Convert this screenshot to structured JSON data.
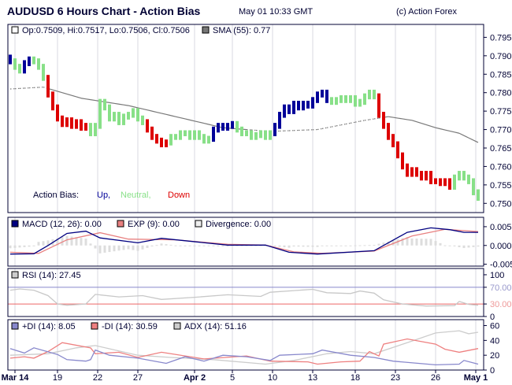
{
  "header": {
    "title": "AUDUSD 6 Hours Chart - Action Bias",
    "timestamp": "May 01 10:33 GMT",
    "credit": "(c) Action Forex"
  },
  "colors": {
    "up": "#000099",
    "neutral": "#88e088",
    "down": "#dd0000",
    "sma": "#777777",
    "macd": "#000080",
    "exp": "#e88080",
    "div": "#dddddd",
    "rsi": "#c8c8c8",
    "plusdi": "#8888cc",
    "minusdi": "#ee8080",
    "adx": "#cccccc",
    "grid": "#d8d8e0",
    "frame": "#000033"
  },
  "chart_data": [
    {
      "type": "bar",
      "title": "Price",
      "legend": {
        "ohlc": "Op:0.7509, Hi:0.7517, Lo:0.7506, Cl:0.7506",
        "sma": "SMA (55): 0.77"
      },
      "bias_legend": {
        "label": "Action Bias:",
        "up": "Up,",
        "neutral": "Neutral,",
        "down": "Down"
      },
      "ylim": [
        0.7475,
        0.7985
      ],
      "yticks": [
        "0.795",
        "0.790",
        "0.785",
        "0.780",
        "0.775",
        "0.770",
        "0.765",
        "0.760",
        "0.755",
        "0.750"
      ],
      "closes": [
        0.7885,
        0.787,
        0.786,
        0.788,
        0.789,
        0.7885,
        0.787,
        0.784,
        0.7795,
        0.776,
        0.773,
        0.7715,
        0.7725,
        0.771,
        0.772,
        0.7705,
        0.771,
        0.769,
        0.771,
        0.7775,
        0.776,
        0.773,
        0.774,
        0.772,
        0.7735,
        0.774,
        0.775,
        0.773,
        0.772,
        0.77,
        0.768,
        0.767,
        0.766,
        0.7665,
        0.768,
        0.768,
        0.769,
        0.769,
        0.768,
        0.769,
        0.768,
        0.767,
        0.7675,
        0.77,
        0.771,
        0.7705,
        0.771,
        0.7715,
        0.77,
        0.769,
        0.769,
        0.768,
        0.7685,
        0.769,
        0.768,
        0.769,
        0.771,
        0.774,
        0.776,
        0.775,
        0.777,
        0.776,
        0.777,
        0.7765,
        0.778,
        0.7795,
        0.78,
        0.778,
        0.7775,
        0.778,
        0.7785,
        0.778,
        0.7785,
        0.777,
        0.7775,
        0.779,
        0.78,
        0.779,
        0.774,
        0.771,
        0.768,
        0.766,
        0.763,
        0.76,
        0.758,
        0.759,
        0.758,
        0.757,
        0.758,
        0.756,
        0.756,
        0.7555,
        0.756,
        0.7545,
        0.757,
        0.758,
        0.757,
        0.756,
        0.753,
        0.7515
      ],
      "bias": "UNNUUNNNDDDDDDDDDNNNNNNNNNNNNDDDDDNNNNNNNNNUUUUUNNNNNNNNUUUUUUUUUUUUNNNNNNNNNNDDDDDDDDDDDDDDDDNNNNNN",
      "sma": [
        [
          0,
          0.781
        ],
        [
          7,
          0.7815
        ],
        [
          15,
          0.7785
        ],
        [
          25,
          0.7765
        ],
        [
          35,
          0.7735
        ],
        [
          45,
          0.7705
        ],
        [
          55,
          0.7695
        ],
        [
          65,
          0.77
        ],
        [
          75,
          0.7725
        ],
        [
          80,
          0.7735
        ],
        [
          85,
          0.7725
        ],
        [
          90,
          0.7705
        ],
        [
          95,
          0.769
        ],
        [
          99,
          0.7665
        ]
      ]
    },
    {
      "type": "line",
      "title": "MACD",
      "legend": {
        "macd": "MACD (12, 26): 0.00",
        "exp": "EXP (9): 0.00",
        "div": "Divergence: 0.00"
      },
      "ylim": [
        -0.0055,
        0.0075
      ],
      "yticks": [
        "0.005",
        "0.000",
        "-0.005"
      ],
      "macd": [
        [
          0,
          -0.0023
        ],
        [
          5,
          -0.0022
        ],
        [
          8,
          0.0
        ],
        [
          12,
          0.0032
        ],
        [
          16,
          0.0038
        ],
        [
          19,
          0.002
        ],
        [
          27,
          0.0007
        ],
        [
          32,
          0.0019
        ],
        [
          46,
          0.0001
        ],
        [
          54,
          0.0001
        ],
        [
          59,
          -0.0018
        ],
        [
          65,
          -0.0023
        ],
        [
          77,
          -0.0014
        ],
        [
          84,
          0.0035
        ],
        [
          89,
          0.0047
        ],
        [
          93,
          0.0042
        ],
        [
          96,
          0.0035
        ],
        [
          99,
          0.0035
        ]
      ],
      "exp": [
        [
          0,
          -0.0018
        ],
        [
          6,
          -0.0021
        ],
        [
          12,
          0.0015
        ],
        [
          19,
          0.0034
        ],
        [
          25,
          0.0017
        ],
        [
          35,
          0.0015
        ],
        [
          46,
          0.0003
        ],
        [
          54,
          0.0001
        ],
        [
          60,
          -0.0017
        ],
        [
          66,
          -0.0021
        ],
        [
          77,
          -0.0015
        ],
        [
          85,
          0.0025
        ],
        [
          92,
          0.0043
        ],
        [
          99,
          0.0037
        ]
      ]
    },
    {
      "type": "line",
      "title": "RSI",
      "legend": {
        "rsi": "RSI (14): 27.45"
      },
      "ylim": [
        0,
        115
      ],
      "yticks": [
        "100",
        "70.00",
        "30.00",
        "0"
      ],
      "levels": [
        70,
        30
      ],
      "rsi": [
        [
          0,
          63
        ],
        [
          2,
          66
        ],
        [
          5,
          63
        ],
        [
          8,
          50
        ],
        [
          10,
          30
        ],
        [
          12,
          27
        ],
        [
          16,
          30
        ],
        [
          18,
          53
        ],
        [
          23,
          47
        ],
        [
          28,
          50
        ],
        [
          32,
          41
        ],
        [
          39,
          46
        ],
        [
          46,
          52
        ],
        [
          53,
          48
        ],
        [
          55,
          58
        ],
        [
          60,
          62
        ],
        [
          64,
          65
        ],
        [
          67,
          57
        ],
        [
          72,
          55
        ],
        [
          74,
          61
        ],
        [
          77,
          56
        ],
        [
          79,
          40
        ],
        [
          83,
          30
        ],
        [
          88,
          25
        ],
        [
          94,
          26
        ],
        [
          95,
          36
        ],
        [
          97,
          29
        ],
        [
          99,
          27
        ]
      ]
    },
    {
      "type": "line",
      "title": "DMI",
      "legend": {
        "plusdi": "+DI (14): 8.05",
        "minusdi": "-DI (14): 30.59",
        "adx": "ADX (14): 51.16"
      },
      "ylim": [
        0,
        68
      ],
      "yticks": [
        "60",
        "40",
        "20",
        "0"
      ],
      "plusdi": [
        [
          0,
          29
        ],
        [
          3,
          23
        ],
        [
          5,
          30
        ],
        [
          10,
          21
        ],
        [
          12,
          14
        ],
        [
          16,
          12
        ],
        [
          17,
          14
        ],
        [
          18,
          27
        ],
        [
          21,
          20
        ],
        [
          27,
          16
        ],
        [
          33,
          9
        ],
        [
          37,
          18
        ],
        [
          41,
          12
        ],
        [
          45,
          20
        ],
        [
          50,
          18
        ],
        [
          55,
          13
        ],
        [
          57,
          20
        ],
        [
          64,
          22
        ],
        [
          66,
          27
        ],
        [
          72,
          20
        ],
        [
          77,
          17
        ],
        [
          81,
          12
        ],
        [
          90,
          7
        ],
        [
          95,
          8
        ],
        [
          96,
          13
        ],
        [
          99,
          8
        ]
      ],
      "minusdi": [
        [
          0,
          16
        ],
        [
          3,
          18
        ],
        [
          5,
          16
        ],
        [
          8,
          25
        ],
        [
          11,
          37
        ],
        [
          17,
          30
        ],
        [
          18,
          22
        ],
        [
          23,
          24
        ],
        [
          27,
          17
        ],
        [
          32,
          24
        ],
        [
          41,
          15
        ],
        [
          50,
          19
        ],
        [
          55,
          12
        ],
        [
          63,
          11
        ],
        [
          65,
          8
        ],
        [
          70,
          11
        ],
        [
          74,
          12
        ],
        [
          76,
          25
        ],
        [
          78,
          19
        ],
        [
          79,
          35
        ],
        [
          84,
          42
        ],
        [
          90,
          35
        ],
        [
          92,
          28
        ],
        [
          95,
          24
        ],
        [
          99,
          29
        ]
      ],
      "adx": [
        [
          0,
          20
        ],
        [
          8,
          22
        ],
        [
          14,
          30
        ],
        [
          18,
          33
        ],
        [
          27,
          20
        ],
        [
          34,
          17
        ],
        [
          43,
          14
        ],
        [
          54,
          8
        ],
        [
          60,
          13
        ],
        [
          67,
          22
        ],
        [
          72,
          25
        ],
        [
          77,
          22
        ],
        [
          84,
          37
        ],
        [
          90,
          50
        ],
        [
          95,
          53
        ],
        [
          97,
          49
        ],
        [
          99,
          51
        ]
      ]
    },
    {
      "type": "axis",
      "xticks": [
        {
          "label": "Mar 14",
          "i": 1,
          "bold": true
        },
        {
          "label": "19",
          "i": 10
        },
        {
          "label": "22",
          "i": 18.5
        },
        {
          "label": "27",
          "i": 27
        },
        {
          "label": "Apr 2",
          "i": 39,
          "bold": true
        },
        {
          "label": "5",
          "i": 47
        },
        {
          "label": "10",
          "i": 55.5
        },
        {
          "label": "13",
          "i": 64
        },
        {
          "label": "18",
          "i": 73
        },
        {
          "label": "23",
          "i": 81.5
        },
        {
          "label": "26",
          "i": 90
        },
        {
          "label": "May 1",
          "i": 98.5,
          "bold": true
        }
      ]
    }
  ]
}
